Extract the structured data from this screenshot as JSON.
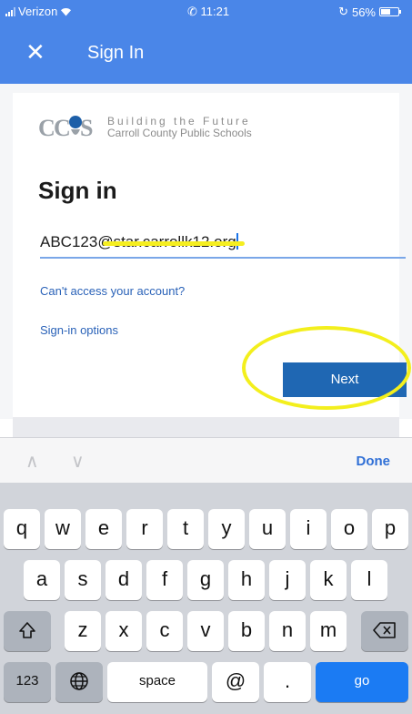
{
  "status_bar": {
    "carrier": "Verizon",
    "time": "11:21",
    "battery": "56%",
    "battery_level": 0.56
  },
  "header": {
    "close_icon": "close-icon",
    "title": "Sign In"
  },
  "logo": {
    "mark_text": "CCPS",
    "line1": "Building the Future",
    "line2": "Carroll County Public Schools"
  },
  "signin": {
    "heading": "Sign in",
    "email_value": "ABC123@star.carrollk12.org",
    "cant_access": "Can't access your account?",
    "options": "Sign-in options",
    "next_label": "Next"
  },
  "annotations": {
    "highlight_color": "#f3ef1d"
  },
  "keyboard": {
    "toolbar": {
      "prev_icon": "chevron-up-icon",
      "next_icon": "chevron-down-icon",
      "done_label": "Done"
    },
    "row1": [
      "q",
      "w",
      "e",
      "r",
      "t",
      "y",
      "u",
      "i",
      "o",
      "p"
    ],
    "row2": [
      "a",
      "s",
      "d",
      "f",
      "g",
      "h",
      "j",
      "k",
      "l"
    ],
    "row3": [
      "z",
      "x",
      "c",
      "v",
      "b",
      "n",
      "m"
    ],
    "shift_icon": "shift-icon",
    "delete_icon": "delete-icon",
    "numbers_label": "123",
    "globe_icon": "globe-icon",
    "space_label": "space",
    "at_label": "@",
    "period_label": ".",
    "go_label": "go"
  },
  "colors": {
    "header_blue": "#4a86e8",
    "next_blue": "#1f67b3",
    "go_blue": "#1b7bf3",
    "link_blue": "#2a62b8"
  }
}
